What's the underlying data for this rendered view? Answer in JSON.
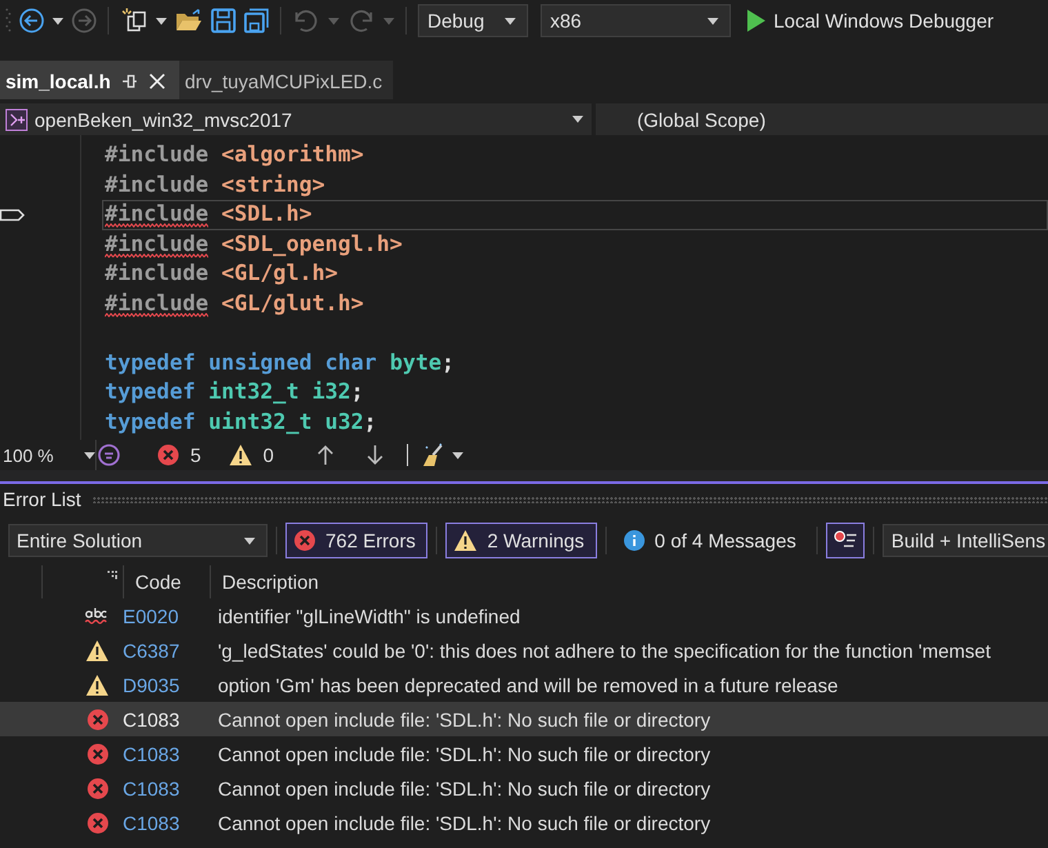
{
  "toolbar": {
    "configuration": "Debug",
    "platform": "x86",
    "run_label": "Local Windows Debugger"
  },
  "tabs": [
    {
      "label": "sim_local.h",
      "selected": true
    },
    {
      "label": "drv_tuyaMCUPixLED.c",
      "selected": false
    }
  ],
  "navigation": {
    "project": "openBeken_win32_mvsc2017",
    "scope": "(Global Scope)"
  },
  "editor": {
    "blocks": [
      {
        "lines": [
          {
            "current": false,
            "squiggle": false,
            "tokens": [
              {
                "kind": "pre",
                "text": "#include"
              },
              {
                "kind": "str",
                "text": "<algorithm>"
              }
            ]
          },
          {
            "current": false,
            "squiggle": false,
            "tokens": [
              {
                "kind": "pre",
                "text": "#include"
              },
              {
                "kind": "str",
                "text": "<string>"
              }
            ]
          },
          {
            "current": true,
            "squiggle": true,
            "tokens": [
              {
                "kind": "pre",
                "text": "#include"
              },
              {
                "kind": "str",
                "text": "<SDL.h>"
              }
            ]
          },
          {
            "current": false,
            "squiggle": true,
            "tokens": [
              {
                "kind": "pre",
                "text": "#include"
              },
              {
                "kind": "str",
                "text": "<SDL_opengl.h>"
              }
            ]
          },
          {
            "current": false,
            "squiggle": false,
            "tokens": [
              {
                "kind": "pre",
                "text": "#include"
              },
              {
                "kind": "str",
                "text": "<GL/gl.h>"
              }
            ]
          },
          {
            "current": false,
            "squiggle": true,
            "tokens": [
              {
                "kind": "pre",
                "text": "#include"
              },
              {
                "kind": "str",
                "text": "<GL/glut.h>"
              }
            ]
          }
        ]
      },
      {
        "lines": [
          {
            "current": false,
            "squiggle": false,
            "tokens": [
              {
                "kind": "kw",
                "text": "typedef"
              },
              {
                "kind": "kw",
                "text": "unsigned"
              },
              {
                "kind": "kw",
                "text": "char"
              },
              {
                "kind": "type",
                "text": "byte"
              },
              {
                "kind": "punct",
                "text": ";"
              }
            ]
          },
          {
            "current": false,
            "squiggle": false,
            "tokens": [
              {
                "kind": "kw",
                "text": "typedef"
              },
              {
                "kind": "type",
                "text": "int32_t"
              },
              {
                "kind": "type",
                "text": "i32"
              },
              {
                "kind": "punct",
                "text": ";"
              }
            ]
          },
          {
            "current": false,
            "squiggle": false,
            "tokens": [
              {
                "kind": "kw",
                "text": "typedef"
              },
              {
                "kind": "type",
                "text": "uint32_t"
              },
              {
                "kind": "type",
                "text": "u32"
              },
              {
                "kind": "punct",
                "text": ";"
              }
            ]
          }
        ]
      }
    ],
    "status": {
      "zoom": "100 %",
      "errors": "5",
      "warnings": "0"
    }
  },
  "error_list": {
    "title": "Error List",
    "scope": "Entire Solution",
    "filters": [
      {
        "kind": "error",
        "label": "762 Errors",
        "selected": true
      },
      {
        "kind": "warning",
        "label": "2 Warnings",
        "selected": true
      },
      {
        "kind": "info",
        "label": "0 of 4 Messages",
        "selected": false
      }
    ],
    "filter_button_selected": true,
    "source": "Build + IntelliSens",
    "columns": [
      "Code",
      "Description"
    ],
    "rows": [
      {
        "kind": "spelling",
        "code": "E0020",
        "description": "identifier \"glLineWidth\" is undefined",
        "selected": false
      },
      {
        "kind": "warning",
        "code": "C6387",
        "description": "'g_ledStates' could be '0':  this does not adhere to the specification for the function 'memset",
        "selected": false
      },
      {
        "kind": "warning",
        "code": "D9035",
        "description": "option 'Gm' has been deprecated and will be removed in a future release",
        "selected": false
      },
      {
        "kind": "error",
        "code": "C1083",
        "description": "Cannot open include file: 'SDL.h': No such file or directory",
        "selected": true
      },
      {
        "kind": "error",
        "code": "C1083",
        "description": "Cannot open include file: 'SDL.h': No such file or directory",
        "selected": false
      },
      {
        "kind": "error",
        "code": "C1083",
        "description": "Cannot open include file: 'SDL.h': No such file or directory",
        "selected": false
      },
      {
        "kind": "error",
        "code": "C1083",
        "description": "Cannot open include file: 'SDL.h': No such file or directory",
        "selected": false
      }
    ]
  }
}
